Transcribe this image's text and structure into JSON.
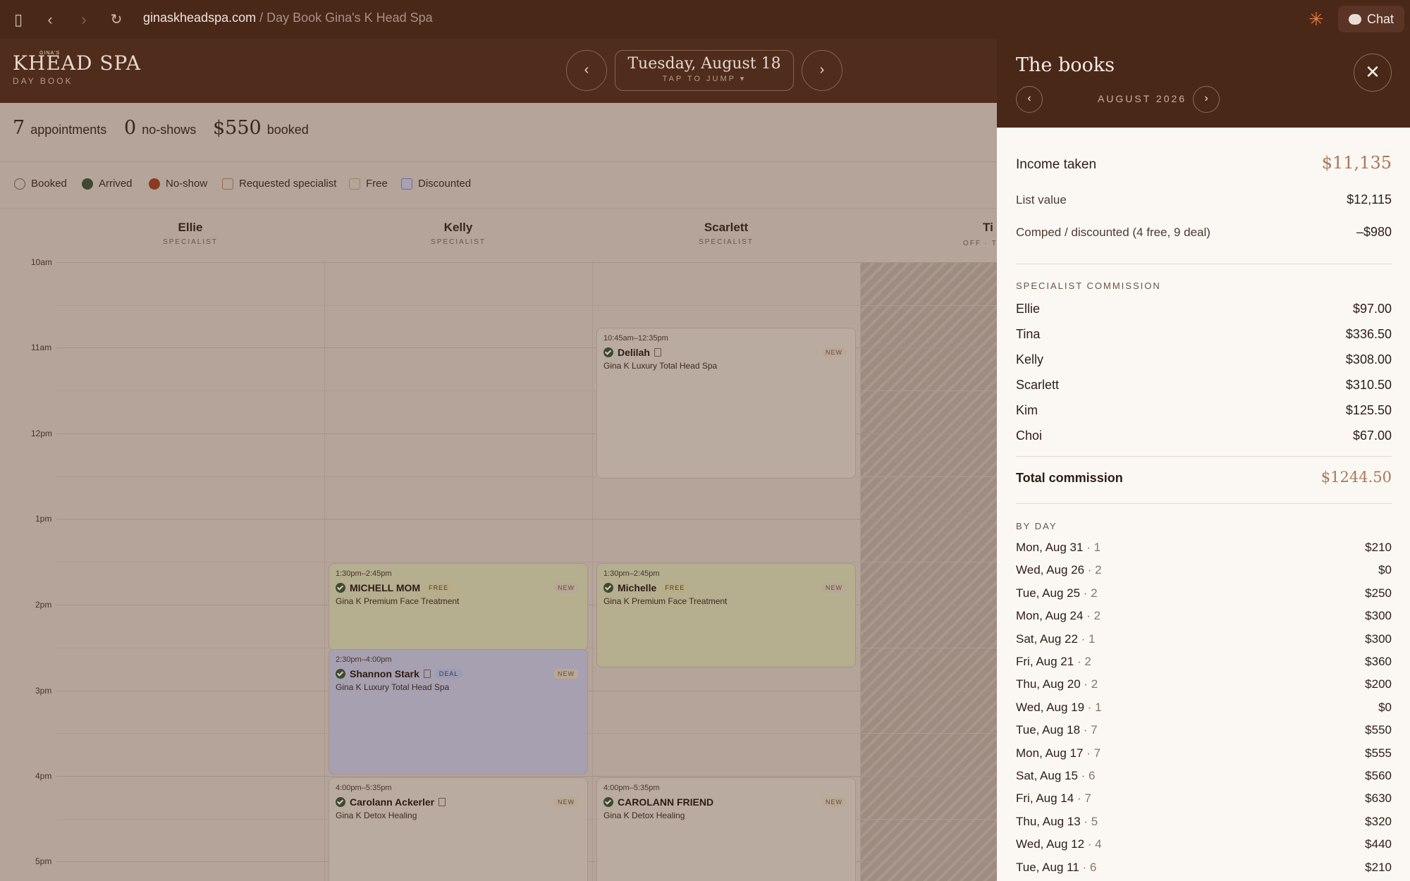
{
  "browser": {
    "domain": "ginaskheadspa.com",
    "path": " / Day Book Gina's K Head Spa",
    "chat_label": "Chat"
  },
  "header": {
    "logo_small": "GINA'S",
    "logo_brand": "KHEAD SPA",
    "logo_sub": "DAY BOOK",
    "date": "Tuesday, August 18",
    "tap_hint": "TAP TO JUMP ▾",
    "prev": "‹",
    "next": "›"
  },
  "stats": [
    {
      "value": "7",
      "label": "appointments"
    },
    {
      "value": "0",
      "label": "no-shows"
    },
    {
      "value": "$550",
      "label": "booked"
    }
  ],
  "legend": [
    "Booked",
    "Arrived",
    "No-show",
    "Requested specialist",
    "Free",
    "Discounted"
  ],
  "columns": [
    {
      "name": "Ellie",
      "role": "SPECIALIST"
    },
    {
      "name": "Kelly",
      "role": "SPECIALIST"
    },
    {
      "name": "Scarlett",
      "role": "SPECIALIST"
    },
    {
      "name": "Ti",
      "role": "OFF · TA"
    }
  ],
  "hours": [
    "10am",
    "11am",
    "12pm",
    "1pm",
    "2pm",
    "3pm",
    "4pm",
    "5pm"
  ],
  "appointments": [
    {
      "time": "10:45am–12:35pm",
      "name": "Delilah",
      "tag": "",
      "new": "NEW",
      "service": "Gina K Luxury Total Head Spa"
    },
    {
      "time": "1:30pm–2:45pm",
      "name": "MICHELL MOM",
      "tag": "FREE",
      "new": "NEW",
      "service": "Gina K Premium Face Treatment"
    },
    {
      "time": "1:30pm–2:45pm",
      "name": "Michelle",
      "tag": "FREE",
      "new": "NEW",
      "service": "Gina K Premium Face Treatment"
    },
    {
      "time": "2:30pm–4:00pm",
      "name": "Shannon Stark",
      "tag": "DEAL",
      "new": "NEW",
      "service": "Gina K Luxury Total Head Spa"
    },
    {
      "time": "4:00pm–5:35pm",
      "name": "Carolann Ackerler",
      "tag": "",
      "new": "NEW",
      "service": "Gina K Detox Healing"
    },
    {
      "time": "4:00pm–5:35pm",
      "name": "CAROLANN FRIEND",
      "tag": "",
      "new": "NEW",
      "service": "Gina K Detox Healing"
    }
  ],
  "panel": {
    "title": "The books",
    "month": "AUGUST 2026",
    "close": "✕",
    "income_label": "Income taken",
    "income_value": "$11,135",
    "list_label": "List value",
    "list_value": "$12,115",
    "comped_label": "Comped / discounted (4 free, 9 deal)",
    "comped_value": "–$980",
    "commission_section": "SPECIALIST COMMISSION",
    "commissions": [
      {
        "name": "Ellie",
        "value": "$97.00"
      },
      {
        "name": "Tina",
        "value": "$336.50"
      },
      {
        "name": "Kelly",
        "value": "$308.00"
      },
      {
        "name": "Scarlett",
        "value": "$310.50"
      },
      {
        "name": "Kim",
        "value": "$125.50"
      },
      {
        "name": "Choi",
        "value": "$67.00"
      }
    ],
    "total_label": "Total commission",
    "total_value": "$1244.50",
    "by_day_section": "BY DAY",
    "days": [
      {
        "day": "Mon, Aug 31",
        "count": "· 1",
        "value": "$210"
      },
      {
        "day": "Wed, Aug 26",
        "count": "· 2",
        "value": "$0"
      },
      {
        "day": "Tue, Aug 25",
        "count": "· 2",
        "value": "$250"
      },
      {
        "day": "Mon, Aug 24",
        "count": "· 2",
        "value": "$300"
      },
      {
        "day": "Sat, Aug 22",
        "count": "· 1",
        "value": "$300"
      },
      {
        "day": "Fri, Aug 21",
        "count": "· 2",
        "value": "$360"
      },
      {
        "day": "Thu, Aug 20",
        "count": "· 2",
        "value": "$200"
      },
      {
        "day": "Wed, Aug 19",
        "count": "· 1",
        "value": "$0"
      },
      {
        "day": "Tue, Aug 18",
        "count": "· 7",
        "value": "$550"
      },
      {
        "day": "Mon, Aug 17",
        "count": "· 7",
        "value": "$555"
      },
      {
        "day": "Sat, Aug 15",
        "count": "· 6",
        "value": "$560"
      },
      {
        "day": "Fri, Aug 14",
        "count": "· 7",
        "value": "$630"
      },
      {
        "day": "Thu, Aug 13",
        "count": "· 5",
        "value": "$320"
      },
      {
        "day": "Wed, Aug 12",
        "count": "· 4",
        "value": "$440"
      },
      {
        "day": "Tue, Aug 11",
        "count": "· 6",
        "value": "$210"
      }
    ]
  },
  "colors": {
    "brand_dark": "#4a2818",
    "accent_gold": "#a87858",
    "free": "#b8b48c",
    "discounted": "#a09cb0"
  }
}
